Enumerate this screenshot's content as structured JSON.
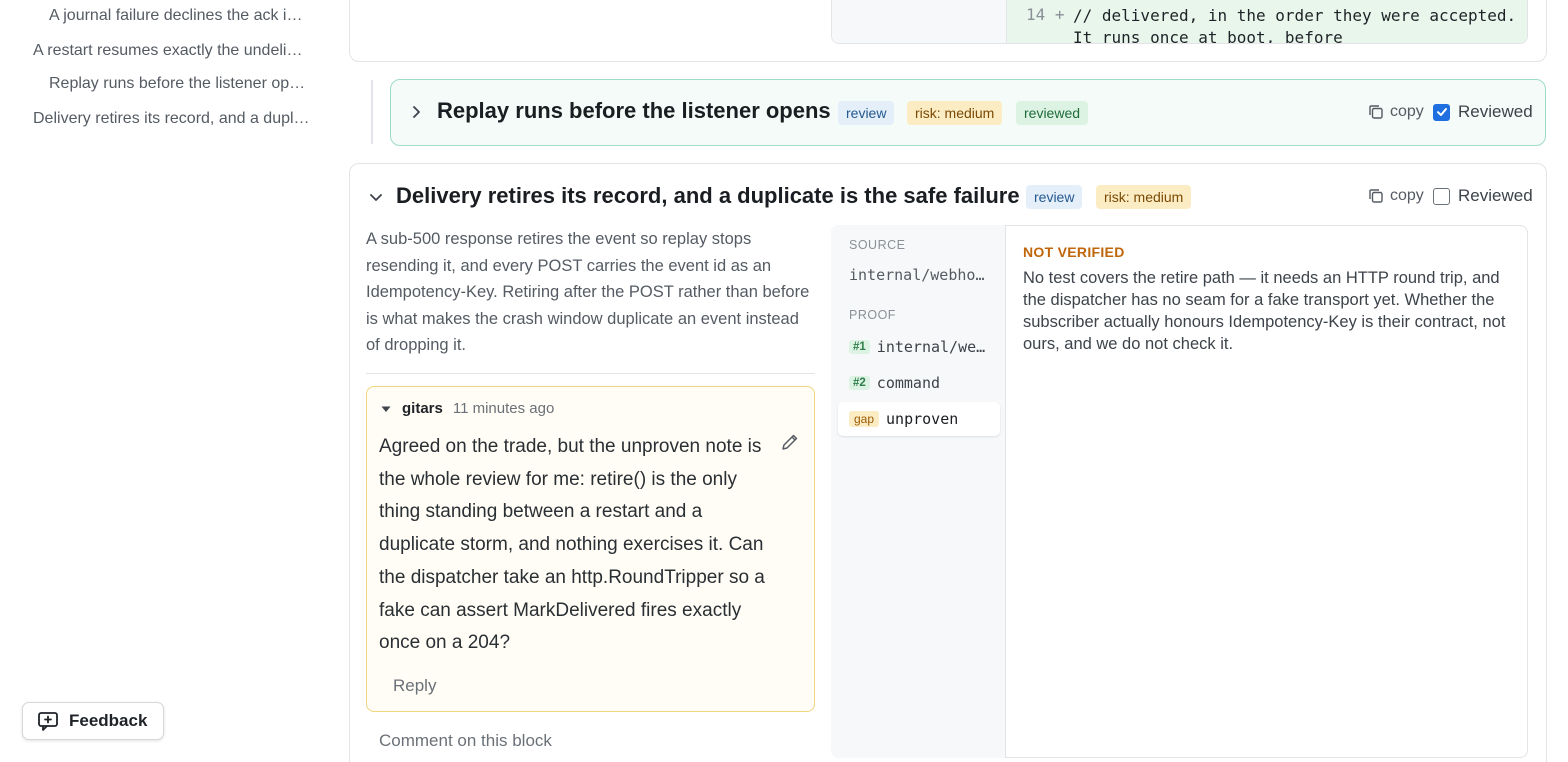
{
  "sidebar": {
    "items": [
      {
        "label": "A journal failure declines the ack i…"
      },
      {
        "label": "A restart resumes exactly the undeli…"
      },
      {
        "label": "Replay runs before the listener op…"
      },
      {
        "label": "Delivery retires its record, and a dupl…"
      }
    ],
    "feedback_label": "Feedback"
  },
  "top_block": {
    "diff_line_number": "14 +",
    "diff_code": "// delivered, in the order they were accepted. It runs once at boot, before"
  },
  "collapsed_block": {
    "title": "Replay runs before the listener opens",
    "badges": {
      "review": "review",
      "risk": "risk: medium",
      "reviewed": "reviewed"
    },
    "copy_label": "copy",
    "reviewed_label": "Reviewed",
    "reviewed_checked": true
  },
  "expanded_block": {
    "title": "Delivery retires its record, and a duplicate is the safe failure",
    "badges": {
      "review": "review",
      "risk": "risk: medium"
    },
    "copy_label": "copy",
    "reviewed_label": "Reviewed",
    "reviewed_checked": false,
    "description": "A sub-500 response retires the event so replay stops resending it, and every POST carries the event id as an Idempotency-Key. Retiring after the POST rather than before is what makes the crash window duplicate an event instead of dropping it.",
    "comment": {
      "author": "gitars",
      "time": "11 minutes ago",
      "body": "Agreed on the trade, but the unproven note is the whole review for me: retire() is the only thing standing between a restart and a duplicate storm, and nothing exercises it. Can the dispatcher take an http.RoundTripper so a fake can assert MarkDelivered fires exactly once on a 204?",
      "reply_label": "Reply"
    },
    "comment_on_block_label": "Comment on this block",
    "proof_panel": {
      "source_heading": "SOURCE",
      "source_path": "internal/webhook",
      "proof_heading": "PROOF",
      "proofs": [
        {
          "tag": "#1",
          "label": "internal/webhook"
        },
        {
          "tag": "#2",
          "label": "command"
        },
        {
          "tag": "gap",
          "label": "unproven"
        }
      ],
      "status_label": "NOT VERIFIED",
      "status_text": "No test covers the retire path — it needs an HTTP round trip, and the dispatcher has no seam for a fake transport yet. Whether the subscriber actually honours Idempotency-Key is their contract, not ours, and we do not check it."
    }
  },
  "colors": {
    "accent": "#1f6fe0",
    "reviewed_border": "#9fdcc7",
    "comment_border": "#f0d680",
    "not_verified": "#c0650a"
  },
  "icons": [
    "chevron-right-icon",
    "chevron-down-icon",
    "copy-icon",
    "checkbox-icon",
    "caret-down-icon",
    "pencil-icon",
    "feedback-icon"
  ]
}
